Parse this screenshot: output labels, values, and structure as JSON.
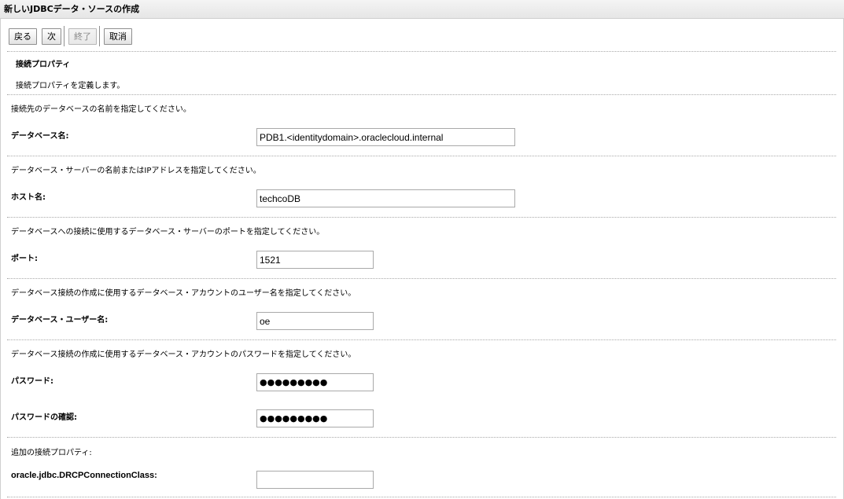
{
  "window": {
    "title": "新しいJDBCデータ・ソースの作成"
  },
  "toolbar": {
    "back_label": "戻る",
    "next_label": "次",
    "finish_label": "終了",
    "cancel_label": "取消"
  },
  "section": {
    "title": "接続プロパティ",
    "description": "接続プロパティを定義します。"
  },
  "fields": {
    "database_name": {
      "help": "接続先のデータベースの名前を指定してください。",
      "label": "データベース名:",
      "value": "PDB1.<identitydomain>.oraclecloud.internal"
    },
    "host_name": {
      "help": "データベース・サーバーの名前またはIPアドレスを指定してください。",
      "label": "ホスト名:",
      "value": "techcoDB"
    },
    "port": {
      "help": "データベースへの接続に使用するデータベース・サーバーのポートを指定してください。",
      "label": "ポート:",
      "value": "1521"
    },
    "db_user": {
      "help": "データベース接続の作成に使用するデータベース・アカウントのユーザー名を指定してください。",
      "label": "データベース・ユーザー名:",
      "value": "oe"
    },
    "password": {
      "help": "データベース接続の作成に使用するデータベース・アカウントのパスワードを指定してください。",
      "label": "パスワード:",
      "value": "●●●●●●●●●"
    },
    "confirm_password": {
      "label": "パスワードの確認:",
      "value": "●●●●●●●●●"
    },
    "additional": {
      "help": "追加の接続プロパティ:",
      "label": "oracle.jdbc.DRCPConnectionClass:",
      "value": ""
    }
  }
}
